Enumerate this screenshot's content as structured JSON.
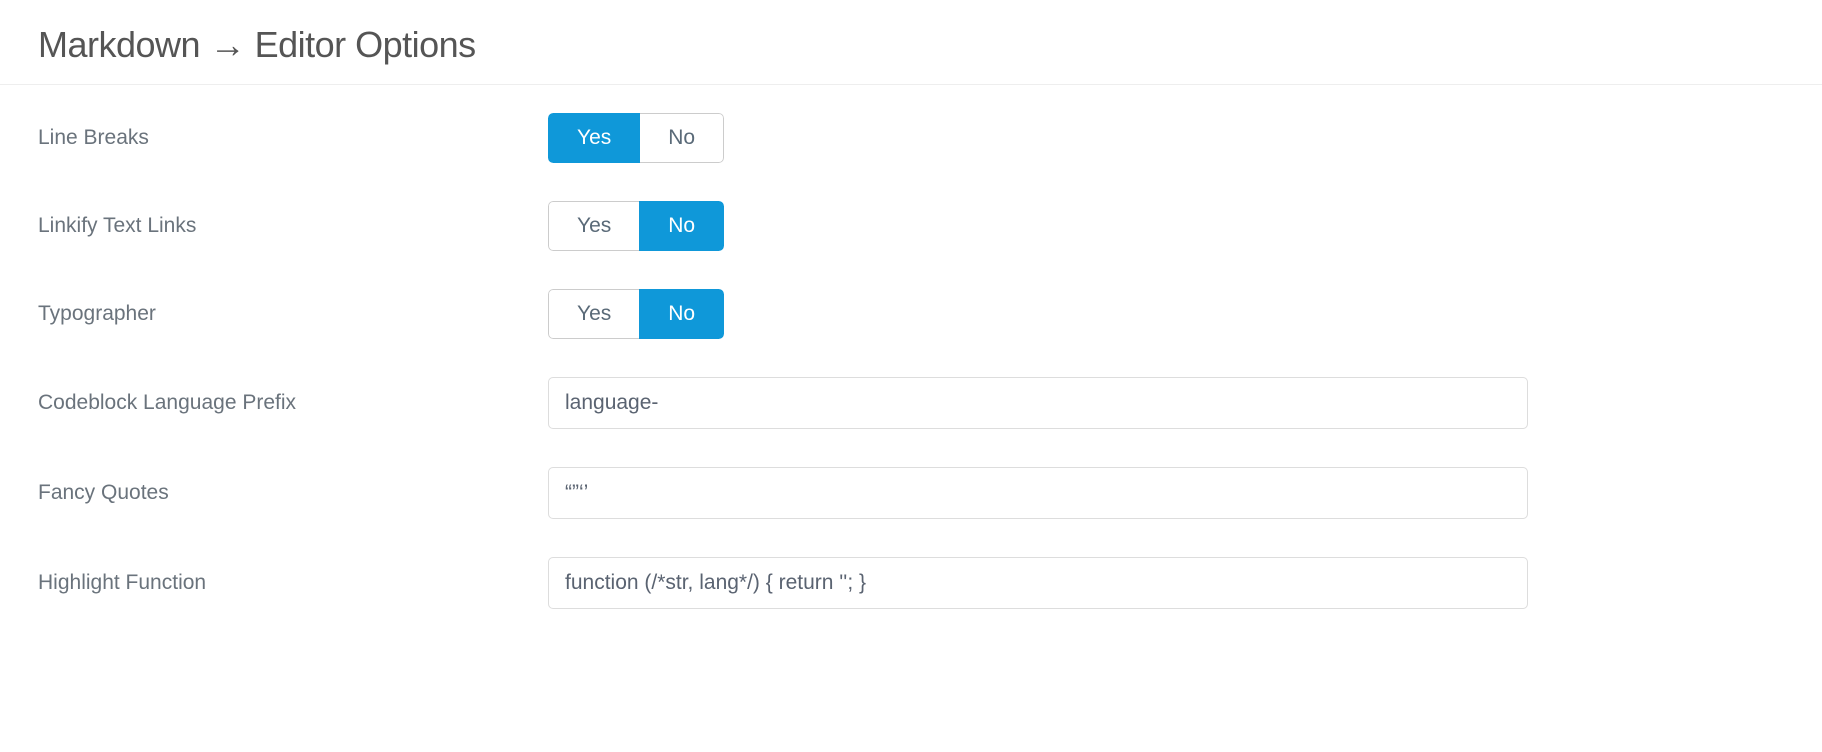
{
  "header": {
    "title": "Markdown → Editor Options"
  },
  "toggle": {
    "yes": "Yes",
    "no": "No"
  },
  "rows": {
    "lineBreaks": {
      "label": "Line Breaks",
      "value": "yes"
    },
    "linkify": {
      "label": "Linkify Text Links",
      "value": "no"
    },
    "typographer": {
      "label": "Typographer",
      "value": "no"
    },
    "codeblockPrefix": {
      "label": "Codeblock Language Prefix",
      "value": "language-"
    },
    "fancyQuotes": {
      "label": "Fancy Quotes",
      "value": "“”‘’"
    },
    "highlightFunction": {
      "label": "Highlight Function",
      "value": "function (/*str, lang*/) { return ''; }"
    }
  }
}
